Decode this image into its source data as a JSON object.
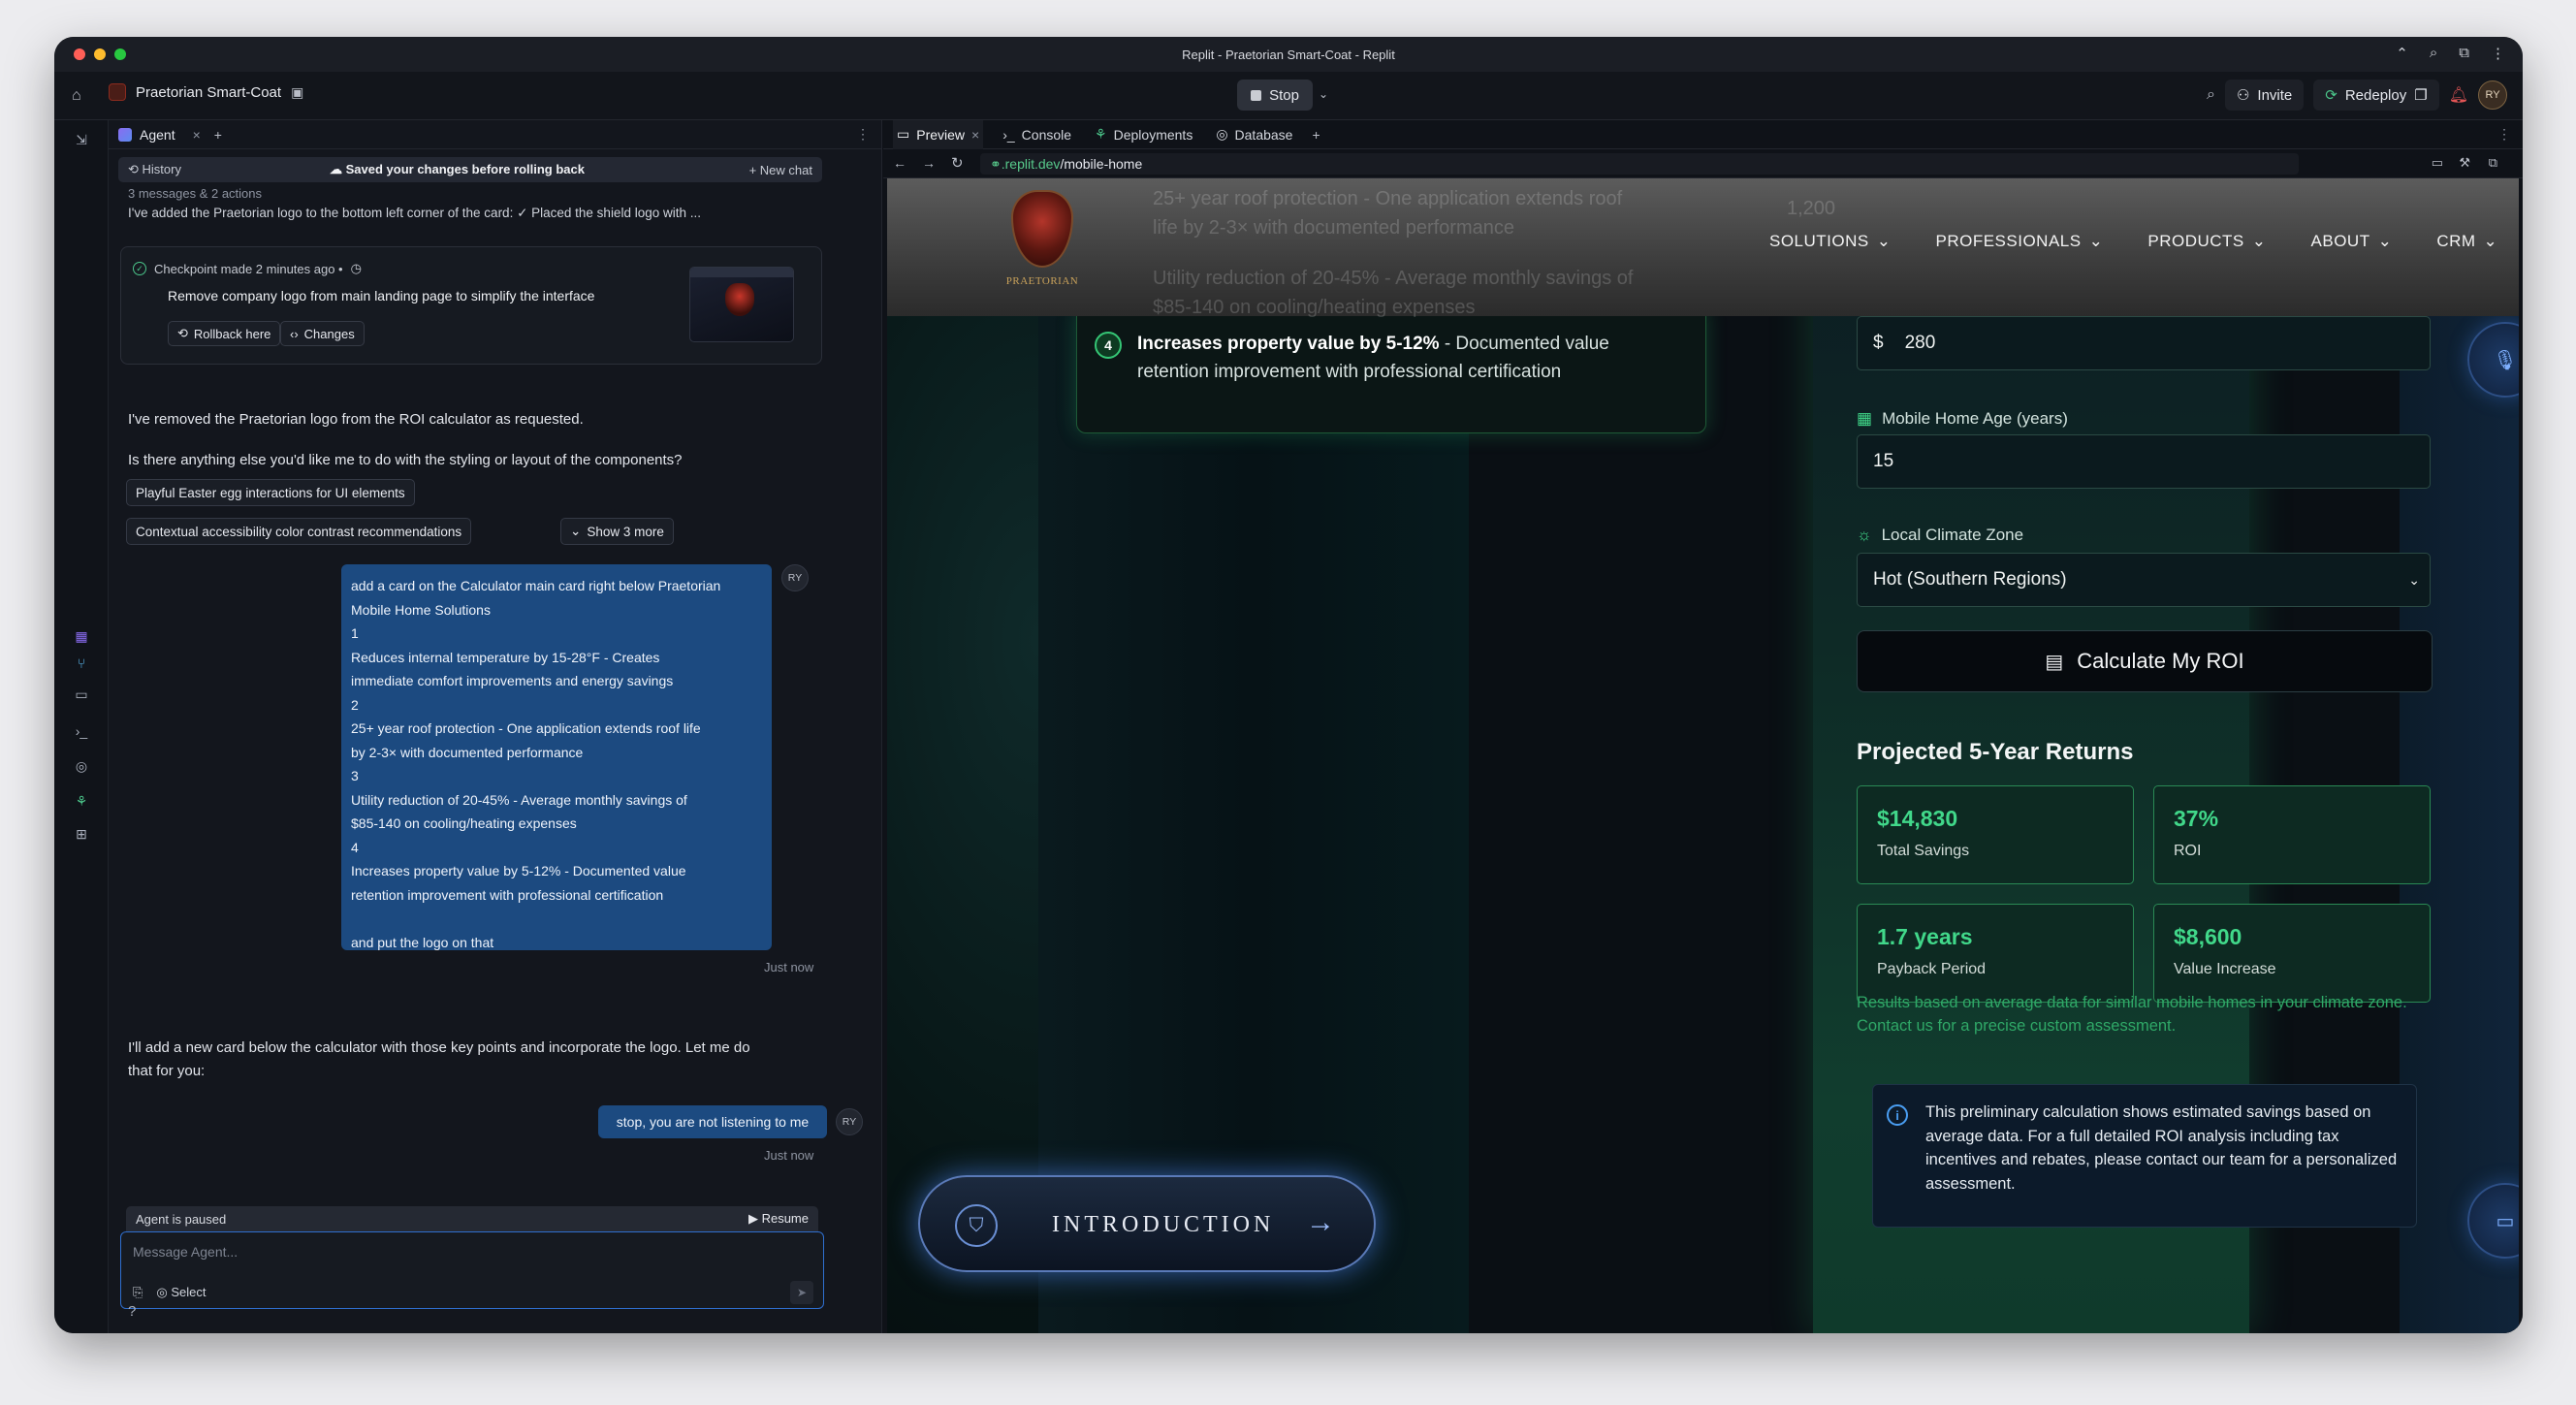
{
  "window": {
    "title": "Replit - Praetorian Smart-Coat - Replit"
  },
  "topbar": {
    "project_name": "Praetorian Smart-Coat",
    "stop_label": "Stop",
    "invite_label": "Invite",
    "redeploy_label": "Redeploy",
    "avatar_initials": "RY"
  },
  "agent": {
    "tab_label": "Agent",
    "history_label": "History",
    "saved_notice": "Saved your changes before rolling back",
    "new_chat_label": "+ New chat",
    "summary": "3 messages & 2 actions",
    "last_message": "I've added the Praetorian logo to the bottom left corner of the card: ✓ Placed the shield logo with ...",
    "checkpoint": {
      "header": "Checkpoint made 2 minutes ago •",
      "description": "Remove company logo from main landing page to simplify the interface",
      "rollback_label": "Rollback here",
      "changes_label": "Changes"
    },
    "msg1": "I've removed the Praetorian logo from the ROI calculator as requested.",
    "msg2": "Is there anything else you'd like me to do with the styling or layout of the components?",
    "suggestions": [
      "Playful Easter egg interactions for UI elements",
      "Contextual accessibility color contrast recommendations"
    ],
    "show_more": "Show 3 more",
    "user_message_lines": [
      "add a card on the Calculator main card right below Praetorian",
      "Mobile Home Solutions",
      "1",
      "Reduces internal temperature by 15-28°F - Creates",
      "immediate comfort improvements and energy savings",
      "2",
      "25+ year roof protection - One application extends roof life",
      "by 2-3× with documented performance",
      "3",
      "Utility reduction of 20-45% - Average monthly savings of",
      "$85-140 on cooling/heating expenses",
      "4",
      "Increases property value by 5-12% - Documented value",
      "retention improvement with professional certification",
      "",
      "and put the logo on that"
    ],
    "timestamp": "Just now",
    "reply_line1": "I'll add a new card below the calculator with those key points and incorporate the logo. Let me do",
    "reply_line2": "that for you:",
    "user_message2": "stop, you are not listening to me",
    "paused_label": "Agent is paused",
    "resume_label": "Resume",
    "composer_placeholder": "Message Agent...",
    "select_label": "Select"
  },
  "right_panel": {
    "tabs": [
      "Preview",
      "Console",
      "Deployments",
      "Database"
    ],
    "url_domain": ".replit.dev",
    "url_path": "/mobile-home"
  },
  "site": {
    "logo_text": "PRAETORIAN",
    "nav": [
      "SOLUTIONS",
      "PROFESSIONALS",
      "PRODUCTS",
      "ABOUT",
      "CRM"
    ],
    "ghost_line1": "25+ year roof protection - One application extends roof",
    "ghost_line2": "life by 2-3× with documented performance",
    "ghost_line3": "Utility reduction of 20-45% - Average monthly savings of",
    "ghost_line4": "$85-140 on cooling/heating expenses",
    "ghost_num": "1,200",
    "benefit": {
      "number": "4",
      "bold": "Increases property value by 5-12%",
      "rest": " - Documented value retention improvement with professional certification"
    },
    "currency_symbol": "$",
    "input_value_1": "280",
    "age_label": "Mobile Home Age (years)",
    "age_value": "15",
    "climate_label": "Local Climate Zone",
    "climate_value": "Hot (Southern Regions)",
    "calc_button": "Calculate My ROI",
    "projected_title": "Projected 5-Year Returns",
    "stats": [
      {
        "value": "$14,830",
        "label": "Total Savings"
      },
      {
        "value": "37%",
        "label": "ROI"
      },
      {
        "value": "1.7 years",
        "label": "Payback Period"
      },
      {
        "value": "$8,600",
        "label": "Value Increase"
      }
    ],
    "disclaimer": "Results based on average data for similar mobile homes in your climate zone. Contact us for a precise custom assessment.",
    "info": "This preliminary calculation shows estimated savings based on average data. For a full detailed ROI analysis including tax incentives and rebates, please contact our team for a personalized assessment.",
    "intro_label": "INTRODUCTION"
  },
  "colors": {
    "accent_green": "#41d88a",
    "user_bubble": "#1c4a80",
    "focus_blue": "#2f6fd0"
  }
}
